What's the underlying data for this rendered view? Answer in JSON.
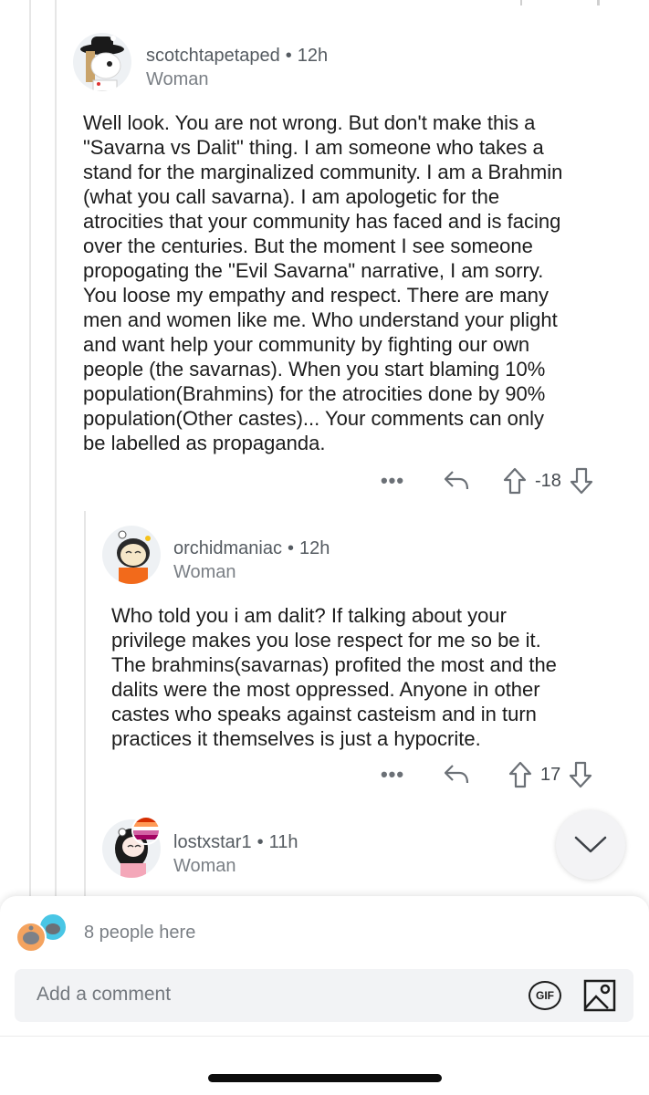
{
  "comments": [
    {
      "username": "scotchtapetaped",
      "age": "12h",
      "flair": "Woman",
      "lines": [
        "Well look. You are not wrong. But don't make this a",
        "\"Savarna vs Dalit\" thing. I am someone who takes a",
        "stand for the marginalized community. I am a Brahmin",
        "(what you call savarna). I am apologetic for the",
        "atrocities that your community has faced and is facing",
        "over the centuries. But the moment I see someone",
        "propogating the \"Evil Savarna\" narrative, I am sorry.",
        "You loose my empathy and respect. There are many",
        "men and women like me. Who understand your plight",
        "and want help your community by fighting our own",
        "people (the savarnas). When you start blaming 10%",
        "population(Brahmins) for the atrocities done by 90%",
        "population(Other castes)... Your comments can only",
        "be labelled as propaganda."
      ],
      "score": "-18"
    },
    {
      "username": "orchidmaniac",
      "age": "12h",
      "flair": "Woman",
      "lines": [
        "Who told you i am dalit? If talking about your",
        "privilege makes you lose respect for me so be it.",
        "The brahmins(savarnas) profited the most and the",
        "dalits were the most oppressed. Anyone in other",
        "castes who speaks against casteism and in turn",
        "practices it themselves is just a hypocrite."
      ],
      "score": "17"
    },
    {
      "username": "lostxstar1",
      "age": "11h",
      "flair": "Woman"
    }
  ],
  "actions": {
    "more": "•••"
  },
  "presence": {
    "text": "8 people here"
  },
  "composer": {
    "placeholder": "Add a comment",
    "gif_label": "GIF"
  },
  "colors": {
    "text": "#1c1c1c",
    "meta": "#555b61",
    "icon": "#6b7076",
    "thread": "#e6e6e6"
  }
}
